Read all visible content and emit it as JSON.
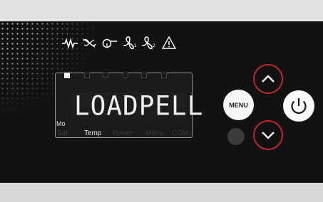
{
  "icons": [
    "heater-icon",
    "fan-off-icon",
    "auger-icon",
    "fan1-icon",
    "fan2-icon",
    "warning-icon"
  ],
  "lcd": {
    "segments_on": [
      true,
      false,
      false,
      false,
      false,
      false
    ],
    "text": "LOADPELL",
    "mode_label": "Mo",
    "labels": [
      {
        "text": "Sat",
        "active": false
      },
      {
        "text": "Temp",
        "active": true
      },
      {
        "text": "Power",
        "active": false
      },
      {
        "text": "Menu",
        "active": false
      },
      {
        "text": "COM",
        "active": false
      }
    ]
  },
  "buttons": {
    "menu_label": "MENU"
  },
  "colors": {
    "panel": "#121212",
    "accent_red": "#c0262b",
    "lcd_text": "#eeeeee"
  }
}
